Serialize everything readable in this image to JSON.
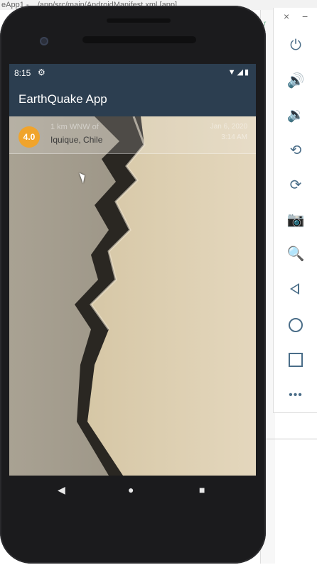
{
  "ide": {
    "title": "eApp1 - .../app/src/main/AndroidManifest.xml [app]",
    "edge_letters": [
      "r",
      "l"
    ]
  },
  "phone": {
    "status": {
      "time": "8:15",
      "gear_icon": "gear-icon",
      "signal_icons": "▼◢▮"
    },
    "app_bar": {
      "title": "EarthQuake App"
    },
    "earthquakes": [
      {
        "magnitude": "4.0",
        "location_offset": "1 km WNW of",
        "primary_location": "Iquique, Chile",
        "date": "Jan 6, 2020",
        "time": "3:14 AM",
        "magnitude_color": "#f0a42c"
      }
    ],
    "nav": {
      "back_icon": "◀",
      "home_icon": "●",
      "recents_icon": "■"
    }
  },
  "emulator": {
    "close_icon": "×",
    "minimize_icon": "−"
  },
  "colors": {
    "primary_dark": "#2c3e50",
    "toolbar_icon": "#4a6d88"
  }
}
